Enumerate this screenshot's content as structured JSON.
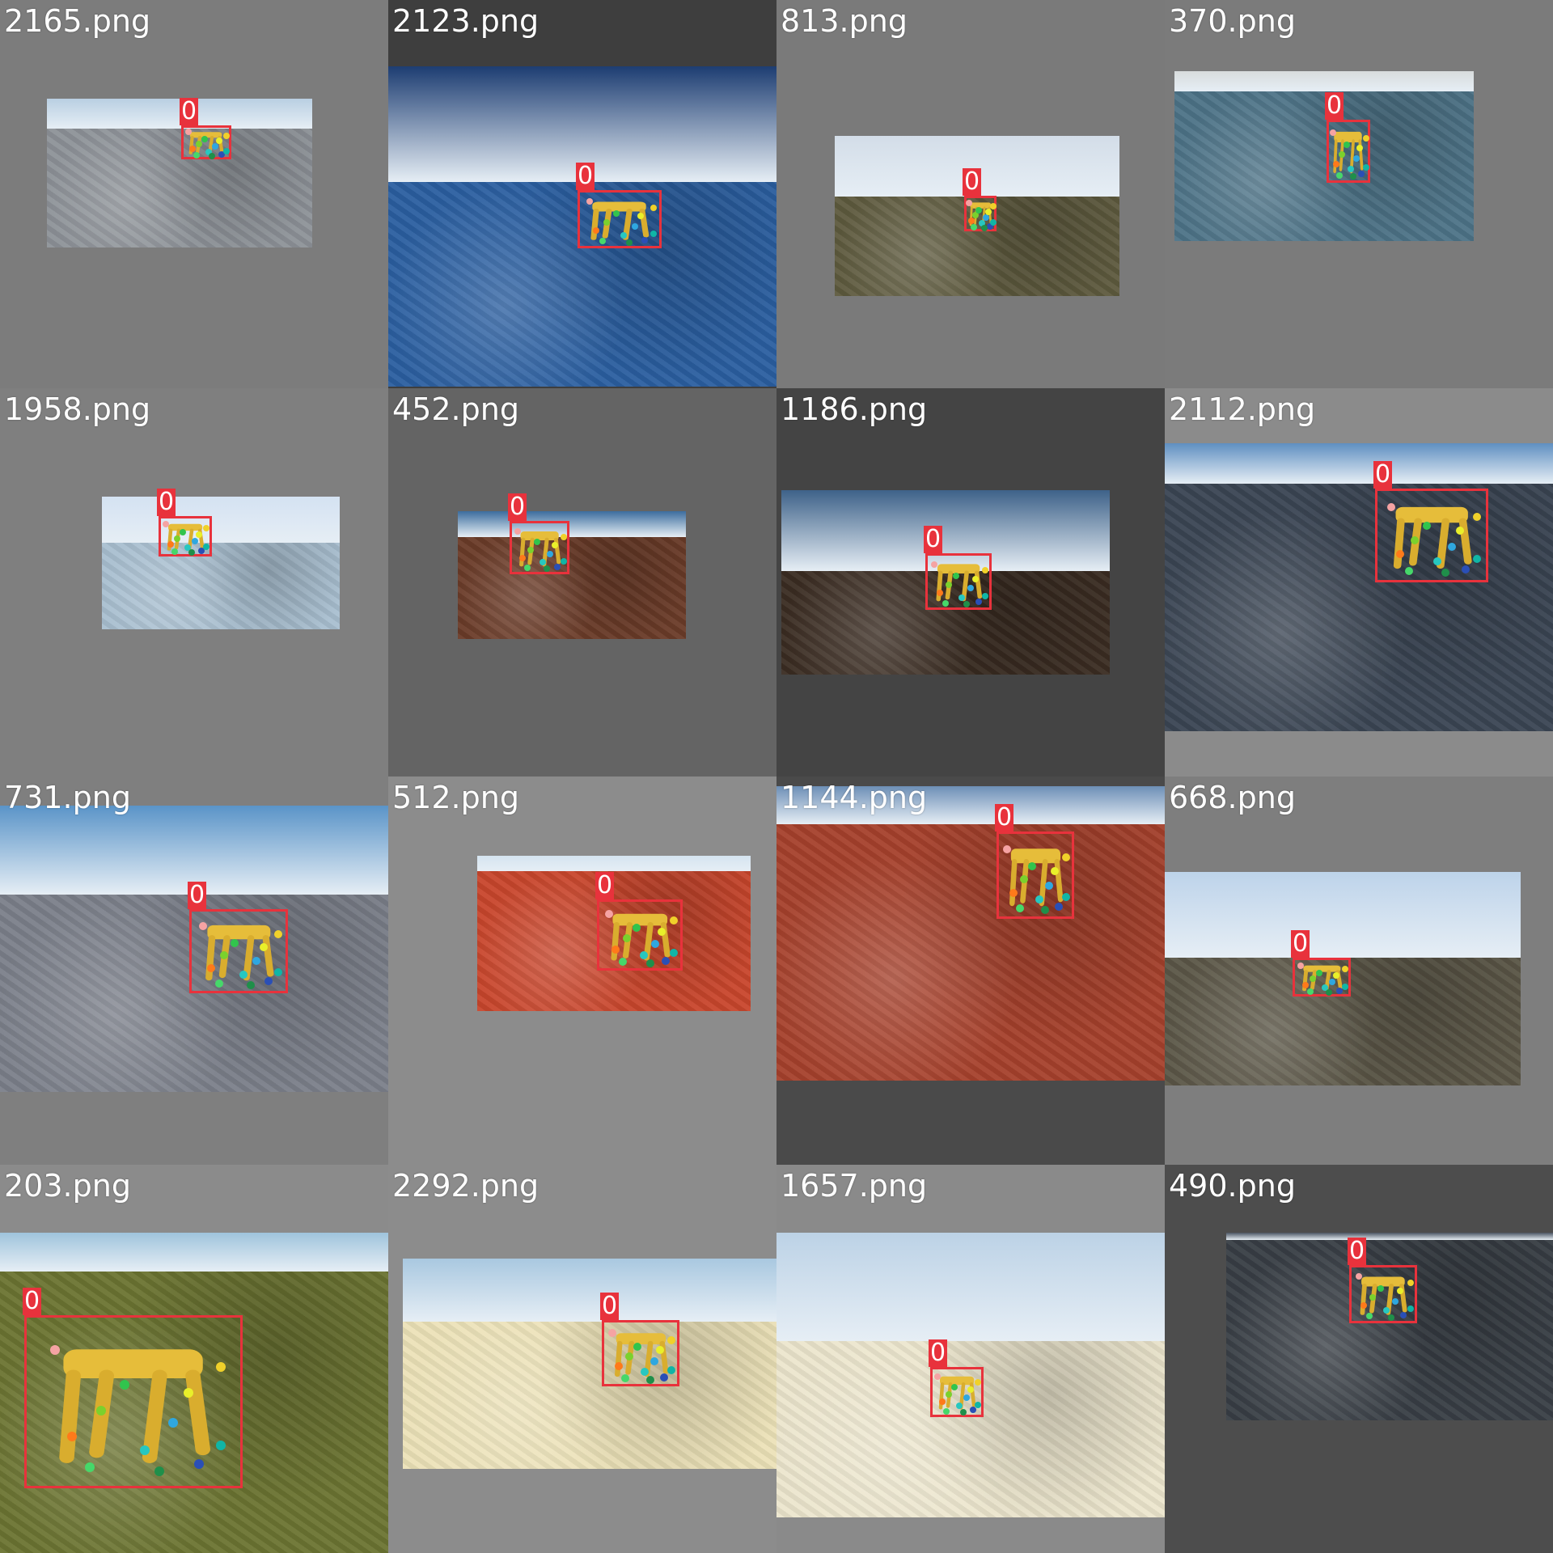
{
  "tiles": [
    {
      "filename": "2165.png",
      "label": "0",
      "bg": "#7c7c7c",
      "sky": "#b9cfe2",
      "ground": "#8d9298",
      "horizon": 0.2
    },
    {
      "filename": "2123.png",
      "label": "0",
      "bg": "#3e3e3e",
      "sky": "#1d3d72",
      "ground": "#2b5fa0",
      "horizon": 0.36
    },
    {
      "filename": "813.png",
      "label": "0",
      "bg": "#7a7a7a",
      "sky": "#d3dde8",
      "ground": "#5e5a3e",
      "horizon": 0.38
    },
    {
      "filename": "370.png",
      "label": "0",
      "bg": "#7b7b7b",
      "sky": "#d8dcdc",
      "ground": "#4d7387",
      "horizon": 0.12
    },
    {
      "filename": "1958.png",
      "label": "0",
      "bg": "#7f7f7f",
      "sky": "#d4e2f2",
      "ground": "#a9bfd0",
      "horizon": 0.35
    },
    {
      "filename": "452.png",
      "label": "0",
      "bg": "#646464",
      "sky": "#3c6d9e",
      "ground": "#6a3b28",
      "horizon": 0.2
    },
    {
      "filename": "1186.png",
      "label": "0",
      "bg": "#444444",
      "sky": "#3e6289",
      "ground": "#3a2c22",
      "horizon": 0.44
    },
    {
      "filename": "2112.png",
      "label": "0",
      "bg": "#8b8b8b",
      "sky": "#5f8fc1",
      "ground": "#3a4553",
      "horizon": 0.14
    },
    {
      "filename": "731.png",
      "label": "0",
      "bg": "#7f7f7f",
      "sky": "#5a94c8",
      "ground": "#7b808a",
      "horizon": 0.31
    },
    {
      "filename": "512.png",
      "label": "0",
      "bg": "#8c8c8c",
      "sky": "#d5e4f0",
      "ground": "#c8462c",
      "horizon": 0.1
    },
    {
      "filename": "1144.png",
      "label": "0",
      "bg": "#4a4a4a",
      "sky": "#6d8fb6",
      "ground": "#a6412c",
      "horizon": 0.13
    },
    {
      "filename": "668.png",
      "label": "0",
      "bg": "#7e7e7e",
      "sky": "#bdd3ea",
      "ground": "#5b5647",
      "horizon": 0.4
    },
    {
      "filename": "203.png",
      "label": "0",
      "bg": "#8b8b8b",
      "sky": "#9fc4dc",
      "ground": "#6b7432",
      "horizon": 0.12
    },
    {
      "filename": "2292.png",
      "label": "0",
      "bg": "#8c8c8c",
      "sky": "#a9c8e0",
      "ground": "#ece2b8",
      "horizon": 0.3
    },
    {
      "filename": "1657.png",
      "label": "0",
      "bg": "#8a8a8a",
      "sky": "#bcd2e6",
      "ground": "#ece6cd",
      "horizon": 0.38
    },
    {
      "filename": "490.png",
      "label": "0",
      "bg": "#4d4d4d",
      "sky": "#4b5563",
      "ground": "#383e45",
      "horizon": 0.04
    }
  ]
}
